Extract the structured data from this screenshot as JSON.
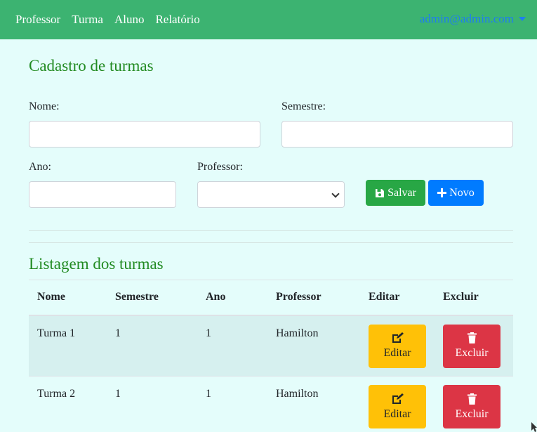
{
  "nav": {
    "links": [
      "Professor",
      "Turma",
      "Aluno",
      "Relatório"
    ],
    "user": "admin@admin.com"
  },
  "form": {
    "title": "Cadastro de turmas",
    "nome_label": "Nome:",
    "nome_value": "",
    "semestre_label": "Semestre:",
    "semestre_value": "",
    "ano_label": "Ano:",
    "ano_value": "",
    "professor_label": "Professor:",
    "professor_selected": "",
    "save_label": "Salvar",
    "save_icon": "floppy-disk-icon",
    "new_label": "Novo",
    "new_icon": "plus-icon"
  },
  "list": {
    "title": "Listagem dos turmas",
    "headers": [
      "Nome",
      "Semestre",
      "Ano",
      "Professor",
      "Editar",
      "Excluir"
    ],
    "rows": [
      {
        "nome": "Turma 1",
        "semestre": "1",
        "ano": "1",
        "professor": "Hamilton",
        "edit_label": "Editar",
        "delete_label": "Excluir"
      },
      {
        "nome": "Turma 2",
        "semestre": "1",
        "ano": "1",
        "professor": "Hamilton",
        "edit_label": "Editar",
        "delete_label": "Excluir"
      }
    ]
  },
  "colors": {
    "navbar": "#3cb371",
    "background": "#e4fdfb",
    "heading": "#228b22",
    "success": "#28a745",
    "primary": "#007bff",
    "warning": "#ffc107",
    "danger": "#dc3545"
  }
}
